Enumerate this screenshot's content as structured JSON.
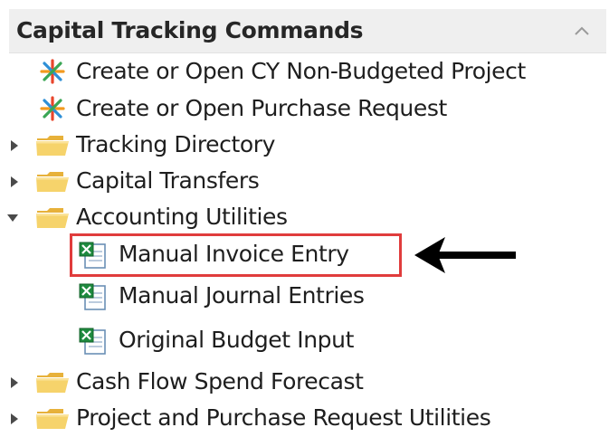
{
  "panel": {
    "title": "Capital Tracking Commands",
    "collapse_icon": "chevron-up-icon"
  },
  "items": [
    {
      "label": "Create or Open CY Non-Budgeted Project",
      "icon": "asterisk-star-icon",
      "kind": "command"
    },
    {
      "label": "Create or Open Purchase Request",
      "icon": "asterisk-star-icon",
      "kind": "command"
    },
    {
      "label": "Tracking Directory",
      "icon": "folder-icon",
      "kind": "folder",
      "expanded": false
    },
    {
      "label": "Capital Transfers",
      "icon": "folder-icon",
      "kind": "folder",
      "expanded": false
    },
    {
      "label": "Accounting Utilities",
      "icon": "folder-icon",
      "kind": "folder",
      "expanded": true
    },
    {
      "label": "Manual Invoice Entry",
      "icon": "excel-icon",
      "kind": "child",
      "highlighted": true
    },
    {
      "label": "Manual Journal Entries",
      "icon": "excel-icon",
      "kind": "child"
    },
    {
      "label": "Original Budget Input",
      "icon": "excel-icon",
      "kind": "child"
    },
    {
      "label": "Cash Flow Spend Forecast",
      "icon": "folder-icon",
      "kind": "folder",
      "expanded": false
    },
    {
      "label": "Project and Purchase Request Utilities",
      "icon": "folder-icon",
      "kind": "folder",
      "expanded": false
    }
  ],
  "annotation": {
    "highlight_color": "#e03c3c",
    "pointer": "black-left-arrow"
  },
  "colors": {
    "header_bg": "#efefef",
    "folder": "#f4c542",
    "excel_green": "#1e8a3e"
  }
}
